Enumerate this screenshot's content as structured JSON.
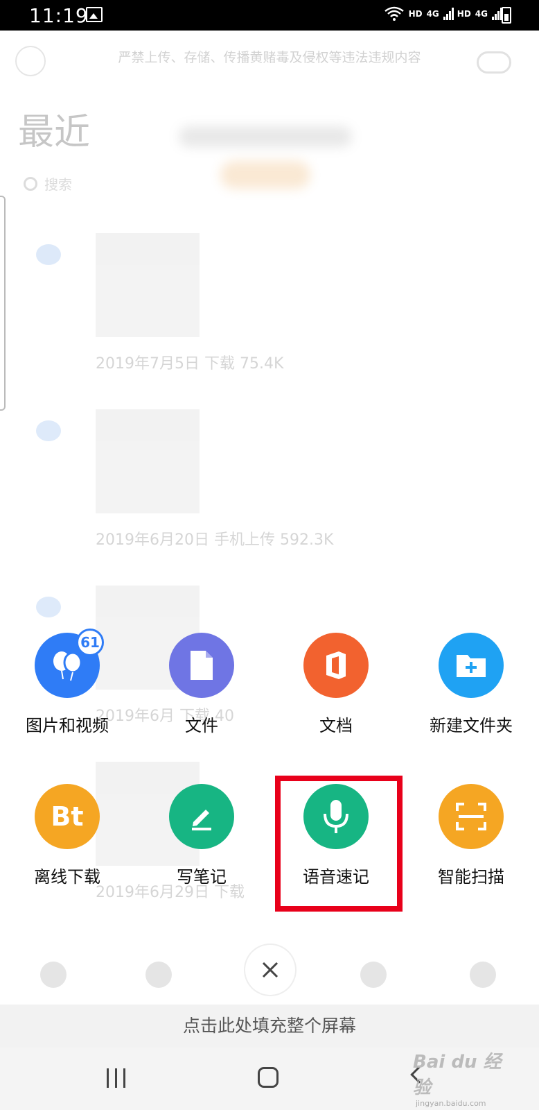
{
  "status_bar": {
    "time": "11:19",
    "network_labels": [
      "HD",
      "4G",
      "HD",
      "4G"
    ],
    "icons": [
      "image-icon",
      "wifi-icon",
      "signal-icon",
      "battery-icon"
    ]
  },
  "background": {
    "notice": "严禁上传、存储、传播黄赌毒及侵权等违法违规内容",
    "title": "最近",
    "search_placeholder": "搜索",
    "feed_captions": [
      "2019年7月5日 下载 75.4K",
      "2019年6月20日 手机上传 592.3K",
      "2019年6月 下载 40",
      "2019年6月29日 下载"
    ]
  },
  "actions": [
    {
      "label": "图片和视频",
      "icon": "balloons-icon",
      "color": "#2f7cf6",
      "badge": "61"
    },
    {
      "label": "文件",
      "icon": "file-icon",
      "color": "#6f75e4"
    },
    {
      "label": "文档",
      "icon": "office-icon",
      "color": "#f2622f"
    },
    {
      "label": "新建文件夹",
      "icon": "new-folder-icon",
      "color": "#1fa2f3"
    },
    {
      "label": "离线下载",
      "icon": "bt-icon",
      "color": "#f5a623"
    },
    {
      "label": "写笔记",
      "icon": "pencil-icon",
      "color": "#17b583"
    },
    {
      "label": "语音速记",
      "icon": "microphone-icon",
      "color": "#17b583"
    },
    {
      "label": "智能扫描",
      "icon": "scan-icon",
      "color": "#f5a623"
    }
  ],
  "bt_text": "Bt",
  "close_icon": "close-icon",
  "fill_screen_text": "点击此处填充整个屏幕",
  "watermark": {
    "brand": "Bai du 经验",
    "url": "jingyan.baidu.com"
  }
}
